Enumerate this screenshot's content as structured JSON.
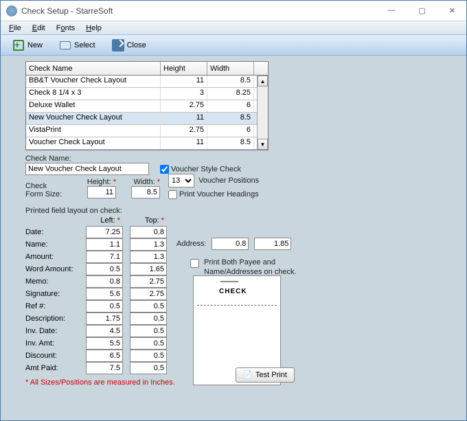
{
  "window": {
    "title": "Check Setup - StarreSoft"
  },
  "menu": {
    "file": "File",
    "edit": "Edit",
    "fonts": "Fonts",
    "help": "Help"
  },
  "toolbar": {
    "new": "New",
    "select": "Select",
    "close": "Close"
  },
  "grid": {
    "headers": {
      "name": "Check Name",
      "height": "Height",
      "width": "Width"
    },
    "rows": [
      {
        "name": "BB&T Voucher Check Layout",
        "h": "11",
        "w": "8.5"
      },
      {
        "name": "Check 8 1/4 x 3",
        "h": "3",
        "w": "8.25"
      },
      {
        "name": "Deluxe Wallet",
        "h": "2.75",
        "w": "6"
      },
      {
        "name": "New Voucher Check Layout",
        "h": "11",
        "w": "8.5"
      },
      {
        "name": "VistaPrint",
        "h": "2.75",
        "w": "6"
      },
      {
        "name": "Voucher Check Layout",
        "h": "11",
        "w": "8.5"
      }
    ]
  },
  "form": {
    "check_name_label": "Check Name:",
    "check_name_value": "New Voucher Check Layout",
    "voucher_style_label": "Voucher Style Check",
    "voucher_positions_label": "Voucher Positions",
    "voucher_positions_value": "13",
    "print_voucher_headings_label": "Print Voucher Headings",
    "check_form_size_label1": "Check",
    "check_form_size_label2": "Form Size:",
    "height_label": "Height:",
    "width_label": "Width:",
    "height_value": "11",
    "width_value": "8.5"
  },
  "layout": {
    "section_label": "Printed field layout on check:",
    "left_header": "Left:",
    "top_header": "Top:",
    "rows": [
      {
        "label": "Date:",
        "left": "7.25",
        "top": "0.8"
      },
      {
        "label": "Name:",
        "left": "1.1",
        "top": "1.3"
      },
      {
        "label": "Amount:",
        "left": "7.1",
        "top": "1.3"
      },
      {
        "label": "Word Amount:",
        "left": "0.5",
        "top": "1.65"
      },
      {
        "label": "Memo:",
        "left": "0.8",
        "top": "2.75"
      },
      {
        "label": "Signature:",
        "left": "5.6",
        "top": "2.75"
      },
      {
        "label": "Ref #:",
        "left": "0.5",
        "top": "0.5"
      },
      {
        "label": "Description:",
        "left": "1.75",
        "top": "0.5"
      },
      {
        "label": "Inv. Date:",
        "left": "4.5",
        "top": "0.5"
      },
      {
        "label": "Inv. Amt:",
        "left": "5.5",
        "top": "0.5"
      },
      {
        "label": "Discount:",
        "left": "6.5",
        "top": "0.5"
      },
      {
        "label": "Amt Paid:",
        "left": "7.5",
        "top": "0.5"
      }
    ]
  },
  "address": {
    "label": "Address:",
    "left": "0.8",
    "top": "1.85"
  },
  "print_both_label": "Print Both Payee and Name/Addresses on check.",
  "preview_label": "CHECK",
  "test_print_label": "Test Print",
  "footnote": "* All Sizes/Positions are measured in Inches."
}
